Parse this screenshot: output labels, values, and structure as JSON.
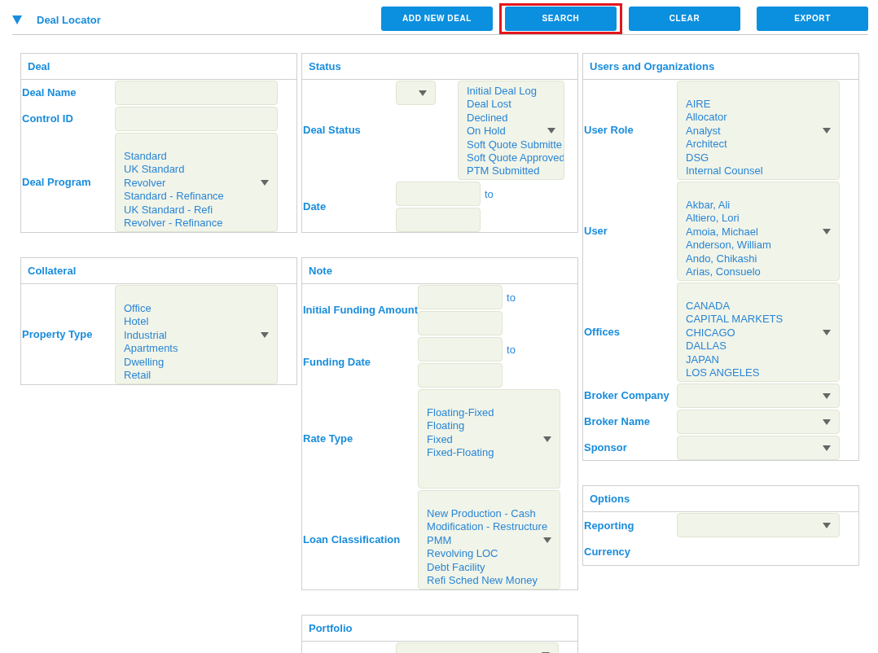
{
  "section": {
    "title": "Deal Locator",
    "expanded": true
  },
  "buttons": [
    {
      "label": "ADD NEW DEAL",
      "highlighted": false
    },
    {
      "label": "SEARCH",
      "highlighted": true
    },
    {
      "label": "CLEAR",
      "highlighted": false
    },
    {
      "label": "EXPORT",
      "highlighted": false
    }
  ],
  "columns": [
    {
      "panels": [
        {
          "title": "Deal",
          "fields": [
            {
              "kind": "text",
              "label": "Deal Name"
            },
            {
              "kind": "text",
              "label": "Control ID"
            },
            {
              "kind": "list",
              "label": "Deal Program",
              "options": [
                "Standard",
                "UK Standard",
                "Revolver",
                "Standard - Refinance",
                "UK Standard - Refi",
                "Revolver - Refinance"
              ]
            }
          ]
        },
        {
          "title": "Collateral",
          "fields": [
            {
              "kind": "list",
              "label": "Property Type",
              "options": [
                "Office",
                "Hotel",
                "Industrial",
                "Apartments",
                "Dwelling",
                "Retail"
              ]
            }
          ]
        }
      ]
    },
    {
      "panels": [
        {
          "title": "Status",
          "fields": [
            {
              "kind": "status",
              "label": "Deal Status",
              "options": [
                "Initial Deal Log",
                "Deal Lost",
                "Declined",
                "On Hold",
                "Soft Quote Submitte",
                "Soft Quote Approved",
                "PTM Submitted"
              ]
            },
            {
              "kind": "range",
              "label": "Date",
              "separator": "to"
            }
          ]
        },
        {
          "title": "Note",
          "fields": [
            {
              "kind": "range",
              "label": "Initial Funding Amount",
              "separator": "to"
            },
            {
              "kind": "range",
              "label": "Funding Date",
              "separator": "to"
            },
            {
              "kind": "list",
              "label": "Rate Type",
              "options": [
                "Floating-Fixed",
                "Floating",
                "Fixed",
                "Fixed-Floating"
              ]
            },
            {
              "kind": "list",
              "label": "Loan Classification",
              "options": [
                "New Production - Cash",
                "Modification - Restructure",
                "PMM",
                "Revolving LOC",
                "Debt Facility",
                "Refi Sched New Money"
              ]
            }
          ]
        },
        {
          "title": "Portfolio",
          "fields": [
            {
              "kind": "select"
            }
          ]
        }
      ]
    },
    {
      "panels": [
        {
          "title": "Users and Organizations",
          "fields": [
            {
              "kind": "list",
              "label": "User Role",
              "options": [
                "AIRE",
                "Allocator",
                "Analyst",
                "Architect",
                "DSG",
                "Internal Counsel"
              ]
            },
            {
              "kind": "list",
              "label": "User",
              "options": [
                "Akbar, Ali",
                "Altiero, Lori",
                "Amoia, Michael",
                "Anderson, William",
                "Ando, Chikashi",
                "Arias, Consuelo"
              ]
            },
            {
              "kind": "list",
              "label": "Offices",
              "options": [
                "CANADA",
                "CAPITAL MARKETS",
                "CHICAGO",
                "DALLAS",
                "JAPAN",
                "LOS ANGELES"
              ]
            },
            {
              "kind": "select",
              "label": "Broker Company"
            },
            {
              "kind": "select",
              "label": "Broker Name"
            },
            {
              "kind": "select",
              "label": "Sponsor"
            }
          ]
        },
        {
          "title": "Options",
          "fields": [
            {
              "kind": "select",
              "label": "Reporting Currency"
            }
          ]
        }
      ]
    }
  ]
}
